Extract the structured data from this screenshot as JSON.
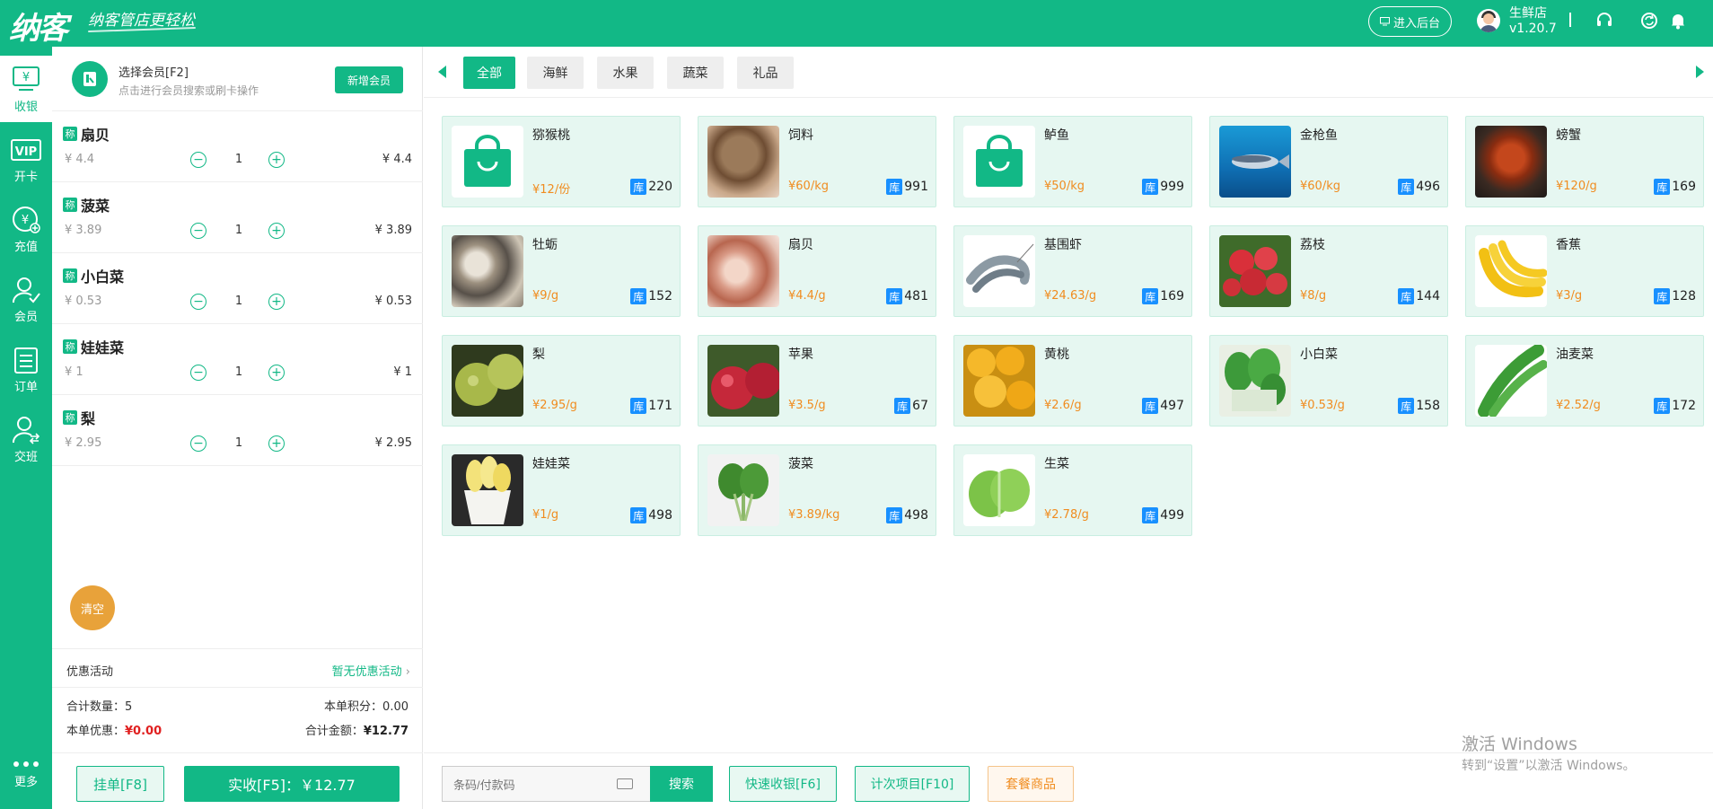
{
  "header": {
    "logo": "纳客",
    "slogan": "纳客管店更轻松",
    "backend_button": "进入后台",
    "store_name": "生鲜店",
    "version": "v1.20.7",
    "icons": [
      "headset-icon",
      "refresh-icon",
      "bell-icon"
    ]
  },
  "nav": {
    "items": [
      {
        "label": "收银",
        "icon": "cashier-icon"
      },
      {
        "label": "开卡",
        "icon": "vip-card-icon"
      },
      {
        "label": "充值",
        "icon": "recharge-icon"
      },
      {
        "label": "会员",
        "icon": "member-icon"
      },
      {
        "label": "订单",
        "icon": "order-icon"
      },
      {
        "label": "交班",
        "icon": "shift-icon"
      }
    ],
    "more": "更多"
  },
  "member": {
    "title": "选择会员[F2]",
    "subtitle": "点击进行会员搜索或刷卡操作",
    "add_button": "新增会员"
  },
  "cart": {
    "tag": "称",
    "items": [
      {
        "name": "扇贝",
        "unit_price": "¥ 4.4",
        "qty": "1",
        "subtotal": "¥ 4.4"
      },
      {
        "name": "菠菜",
        "unit_price": "¥ 3.89",
        "qty": "1",
        "subtotal": "¥ 3.89"
      },
      {
        "name": "小白菜",
        "unit_price": "¥ 0.53",
        "qty": "1",
        "subtotal": "¥ 0.53"
      },
      {
        "name": "娃娃菜",
        "unit_price": "¥ 1",
        "qty": "1",
        "subtotal": "¥ 1"
      },
      {
        "name": "梨",
        "unit_price": "¥ 2.95",
        "qty": "1",
        "subtotal": "¥ 2.95"
      }
    ],
    "clear_button": "清空",
    "promo_label": "优惠活动",
    "promo_value": "暂无优惠活动",
    "total_qty_label": "合计数量：",
    "total_qty": "5",
    "points_label": "本单积分：",
    "points": "0.00",
    "discount_label": "本单优惠：",
    "discount": "¥0.00",
    "total_label": "合计金额：",
    "total": "¥12.77",
    "hold_button": "挂单[F8]",
    "pay_button": "实收[F5]：￥12.77"
  },
  "categories": {
    "tabs": [
      "全部",
      "海鲜",
      "水果",
      "蔬菜",
      "礼品"
    ],
    "active": "全部"
  },
  "products": {
    "stock_badge": "库",
    "items": [
      {
        "name": "猕猴桃",
        "price": "¥12/份",
        "stock": "220",
        "image": "bag-icon"
      },
      {
        "name": "饲料",
        "price": "¥60/kg",
        "stock": "991",
        "image": "feed-photo"
      },
      {
        "name": "鲈鱼",
        "price": "¥50/kg",
        "stock": "999",
        "image": "bag-icon"
      },
      {
        "name": "金枪鱼",
        "price": "¥60/kg",
        "stock": "496",
        "image": "tuna-photo"
      },
      {
        "name": "螃蟹",
        "price": "¥120/g",
        "stock": "169",
        "image": "crab-photo"
      },
      {
        "name": "牡蛎",
        "price": "¥9/g",
        "stock": "152",
        "image": "oyster-photo"
      },
      {
        "name": "扇贝",
        "price": "¥4.4/g",
        "stock": "481",
        "image": "scallop-photo"
      },
      {
        "name": "基围虾",
        "price": "¥24.63/g",
        "stock": "169",
        "image": "shrimp-photo"
      },
      {
        "name": "荔枝",
        "price": "¥8/g",
        "stock": "144",
        "image": "lychee-photo"
      },
      {
        "name": "香蕉",
        "price": "¥3/g",
        "stock": "128",
        "image": "banana-photo"
      },
      {
        "name": "梨",
        "price": "¥2.95/g",
        "stock": "171",
        "image": "pear-photo"
      },
      {
        "name": "苹果",
        "price": "¥3.5/g",
        "stock": "67",
        "image": "apple-photo"
      },
      {
        "name": "黄桃",
        "price": "¥2.6/g",
        "stock": "497",
        "image": "peach-photo"
      },
      {
        "name": "小白菜",
        "price": "¥0.53/g",
        "stock": "158",
        "image": "bokchoy-photo"
      },
      {
        "name": "油麦菜",
        "price": "¥2.52/g",
        "stock": "172",
        "image": "lettuce-leaf-photo"
      },
      {
        "name": "娃娃菜",
        "price": "¥1/g",
        "stock": "498",
        "image": "baby-cabbage-photo"
      },
      {
        "name": "菠菜",
        "price": "¥3.89/kg",
        "stock": "498",
        "image": "spinach-photo"
      },
      {
        "name": "生菜",
        "price": "¥2.78/g",
        "stock": "499",
        "image": "lettuce-photo"
      }
    ]
  },
  "footer": {
    "search_placeholder": "条码/付款码",
    "search_button": "搜索",
    "quick_checkout": "快速收银[F6]",
    "count_items": "计次项目[F10]",
    "package_goods": "套餐商品"
  },
  "watermark": {
    "line1": "激活 Windows",
    "line2": "转到“设置”以激活 Windows。"
  },
  "colors": {
    "primary": "#12b886",
    "price": "#f08c1f",
    "stock_badge": "#1890ff",
    "clear_button": "#e8a23a",
    "discount": "#e02020"
  }
}
